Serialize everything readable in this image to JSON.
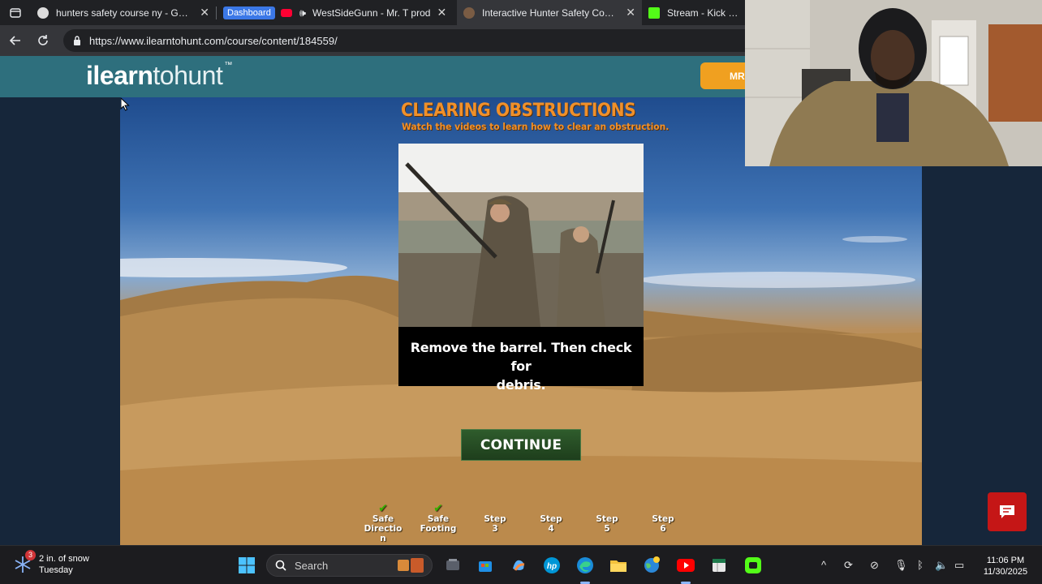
{
  "browser": {
    "tabs": [
      {
        "title": "hunters safety course ny - Google",
        "favicon_color": "#dcdcdc",
        "active": false
      },
      {
        "badge": "Dashboard",
        "favicon_color": "#ff0033",
        "title": "WestSideGunn - Mr. T prod",
        "active": false
      },
      {
        "title": "Interactive Hunter Safety Course",
        "favicon_color": "#7a5c44",
        "active": true
      },
      {
        "title": "Stream - Kick Dash",
        "favicon_color": "#53fc18",
        "active": false
      }
    ],
    "url": "https://www.ilearntohunt.com/course/content/184559/"
  },
  "site": {
    "logo_bold": "ilearn",
    "logo_light": "tohunt",
    "logo_tm": "™",
    "header_button": "MR"
  },
  "lesson": {
    "title": "CLEARING OBSTRUCTIONS",
    "subtitle": "Watch the videos to learn how to clear an obstruction.",
    "caption_line1": "Remove the barrel. Then check for",
    "caption_line2": "debris.",
    "continue_label": "CONTINUE",
    "steps": [
      {
        "line1": "Safe",
        "line2": "Directio",
        "line3": "n",
        "done": true
      },
      {
        "line1": "Safe",
        "line2": "Footing",
        "line3": "",
        "done": true
      },
      {
        "line1": "Step",
        "line2": "3",
        "line3": "",
        "done": false
      },
      {
        "line1": "Step",
        "line2": "4",
        "line3": "",
        "done": false
      },
      {
        "line1": "Step",
        "line2": "5",
        "line3": "",
        "done": false
      },
      {
        "line1": "Step",
        "line2": "6",
        "line3": "",
        "done": false
      }
    ]
  },
  "taskbar": {
    "weather_line1": "2 in. of snow",
    "weather_line2": "Tuesday",
    "weather_badge": "3",
    "search_placeholder": "Search",
    "time": "11:06 PM",
    "date": "11/30/2025",
    "tray_chevron": "^"
  },
  "colors": {
    "header_teal": "#2e6f7d",
    "accent_orange": "#f0902a",
    "continue_green": "#2f5c2c",
    "check_green": "#38b000",
    "chat_red": "#c51616"
  }
}
